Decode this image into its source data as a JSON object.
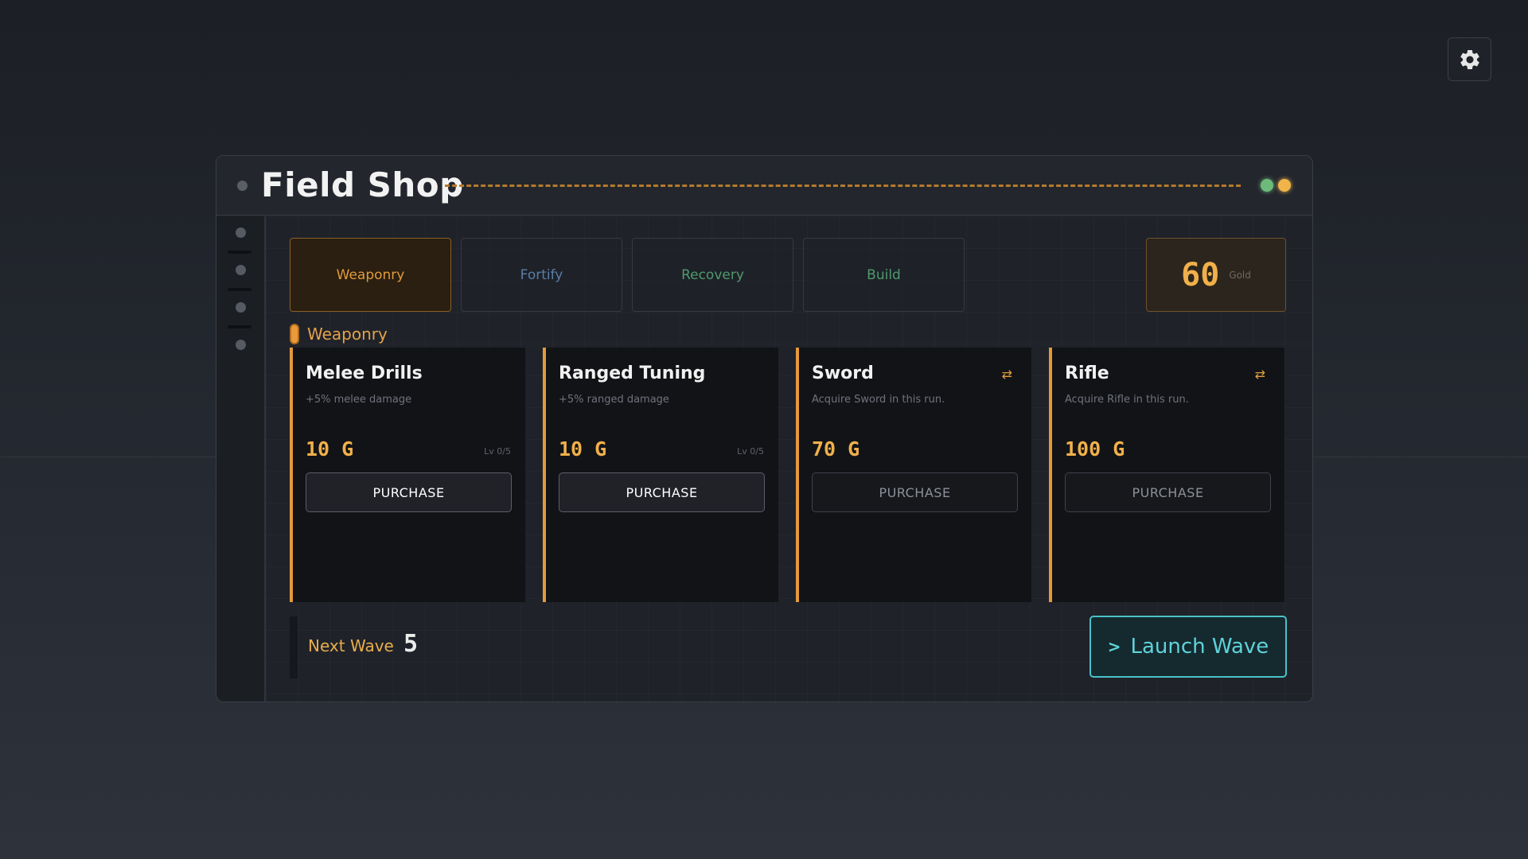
{
  "settings": {
    "icon": "gear-icon"
  },
  "panel": {
    "title": "Field Shop"
  },
  "tabs": [
    {
      "label": "Weaponry",
      "color": "#e29a3c",
      "active": true
    },
    {
      "label": "Fortify",
      "color": "#5b7ea6",
      "active": false
    },
    {
      "label": "Recovery",
      "color": "#4f9a6e",
      "active": false
    },
    {
      "label": "Build",
      "color": "#4f9a6e",
      "active": false
    }
  ],
  "gold": {
    "amount": "60",
    "label": "Gold"
  },
  "section": {
    "label": "Weaponry"
  },
  "cards": [
    {
      "name": "Melee Drills",
      "desc": "+5% melee damage",
      "price": "10 G",
      "level": "Lv 0/5",
      "swap": "",
      "button": "PURCHASE",
      "enabled": true
    },
    {
      "name": "Ranged Tuning",
      "desc": "+5% ranged damage",
      "price": "10 G",
      "level": "Lv 0/5",
      "swap": "",
      "button": "PURCHASE",
      "enabled": true
    },
    {
      "name": "Sword",
      "desc": "Acquire Sword in this run.",
      "price": "70 G",
      "level": "",
      "swap": "⇄",
      "button": "PURCHASE",
      "enabled": false
    },
    {
      "name": "Rifle",
      "desc": "Acquire Rifle in this run.",
      "price": "100 G",
      "level": "",
      "swap": "⇄",
      "button": "PURCHASE",
      "enabled": false
    }
  ],
  "wave": {
    "label": "Next Wave",
    "number": "5"
  },
  "launch": {
    "caret": ">",
    "label": "Launch Wave"
  },
  "colors": {
    "accent": "#e89b3a",
    "gold": "#f0b04a",
    "launch": "#49c1c9"
  }
}
